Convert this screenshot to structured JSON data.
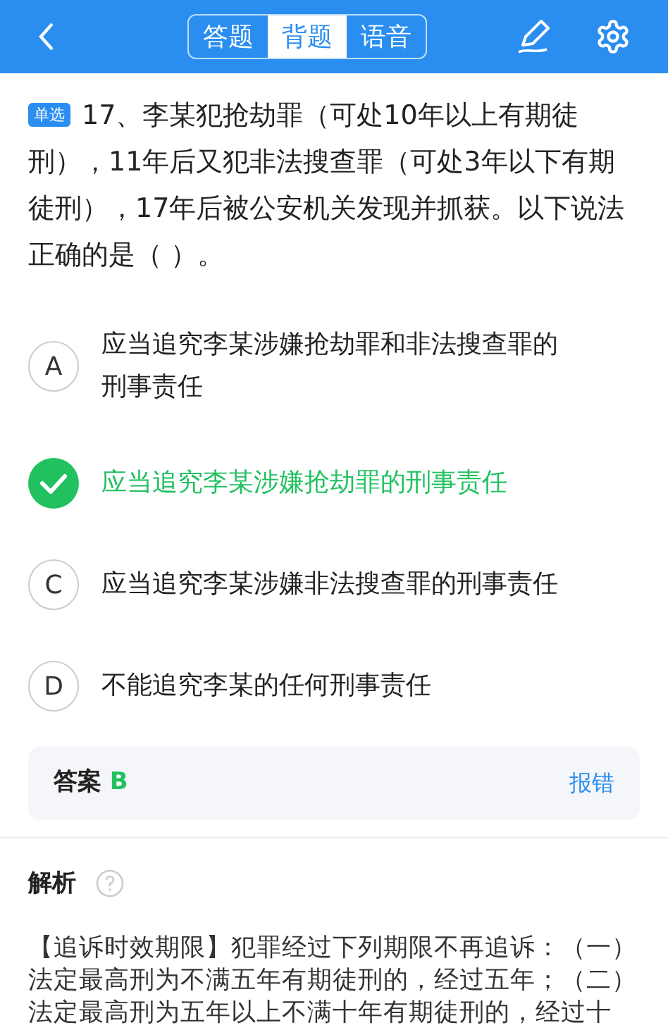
{
  "header": {
    "tabs": [
      {
        "label": "答题",
        "selected": false
      },
      {
        "label": "背题",
        "selected": true
      },
      {
        "label": "语音",
        "selected": false
      }
    ]
  },
  "question": {
    "badge": "单选",
    "text": "17、李某犯抢劫罪（可处10年以上有期徒刑），11年后又犯非法搜查罪（可处3年以下有期徒刑），17年后被公安机关发现并抓获。以下说法正确的是（ ）。"
  },
  "options": [
    {
      "letter": "A",
      "text": "应当追究李某涉嫌抢劫罪和非法搜查罪的刑事责任",
      "selected": false
    },
    {
      "text": "应当追究李某涉嫌抢劫罪的刑事责任",
      "selected": true
    },
    {
      "letter": "C",
      "text": "应当追究李某涉嫌非法搜查罪的刑事责任",
      "selected": false
    },
    {
      "letter": "D",
      "text": "不能追究李某的任何刑事责任",
      "selected": false
    }
  ],
  "answer": {
    "label": "答案",
    "value": "B",
    "report": "报错"
  },
  "analysis": {
    "title": "解析",
    "text": "【追诉时效期限】犯罪经过下列期限不再追诉：（一）法定最高刑为不满五年有期徒刑的，经过五年；（二）法定最高刑为五年以上不满十年有期徒刑的，经过十"
  }
}
